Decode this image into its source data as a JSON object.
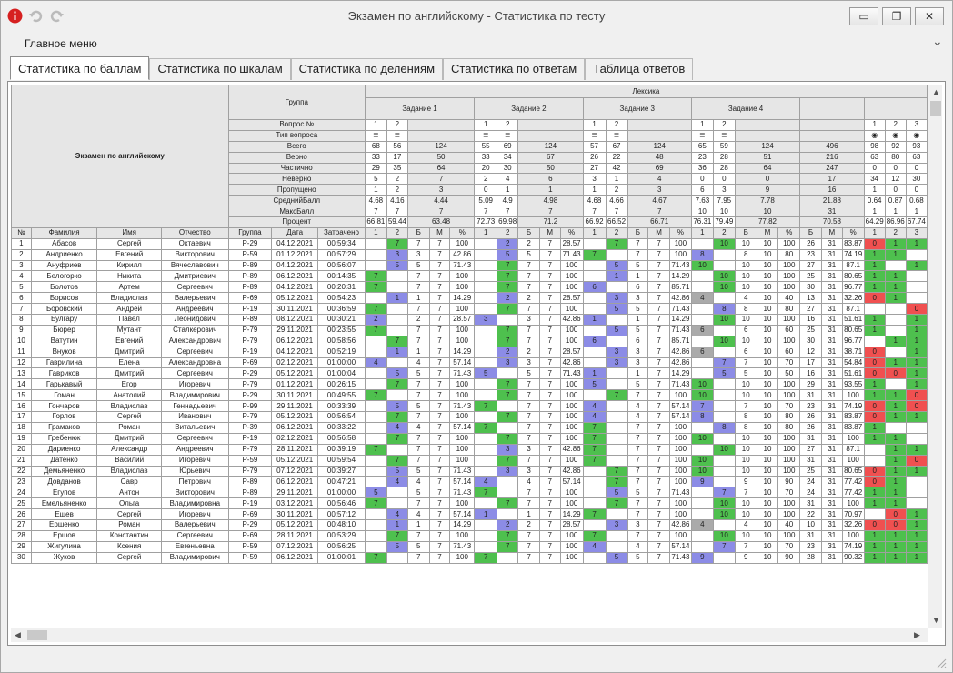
{
  "window": {
    "title": "Экзамен по английскому - Статистика по тесту",
    "min": "▭",
    "max": "❐",
    "close": "✕"
  },
  "menu": {
    "main": "Главное меню",
    "expand": "⌄"
  },
  "tabs": [
    "Статистика по баллам",
    "Статистика по шкалам",
    "Статистика по делениям",
    "Статистика по ответам",
    "Таблица ответов"
  ],
  "head": {
    "test": "Экзамен по английскому",
    "group": "Группа",
    "section": "Лексика",
    "tasks": [
      "Задание 1",
      "Задание 2",
      "Задание 3",
      "Задание 4"
    ],
    "stat_labels": [
      "Вопрос №",
      "Тип вопроса",
      "Всего",
      "Верно",
      "Частично",
      "Неверно",
      "Пропущено",
      "СреднийБалл",
      "МаксБалл",
      "Процент"
    ],
    "stats": [
      [
        "1",
        "2",
        "",
        "1",
        "2",
        "",
        "1",
        "2",
        "",
        "1",
        "2",
        "",
        "",
        "1",
        "2",
        "3"
      ],
      [
        "≣",
        "≣",
        "",
        "≣",
        "≣",
        "",
        "≣",
        "≣",
        "",
        "≣",
        "≣",
        "",
        "",
        "◉",
        "◉",
        "◉"
      ],
      [
        "68",
        "56",
        "124",
        "55",
        "69",
        "124",
        "57",
        "67",
        "124",
        "65",
        "59",
        "124",
        "496",
        "98",
        "92",
        "93"
      ],
      [
        "33",
        "17",
        "50",
        "33",
        "34",
        "67",
        "26",
        "22",
        "48",
        "23",
        "28",
        "51",
        "216",
        "63",
        "80",
        "63"
      ],
      [
        "29",
        "35",
        "64",
        "20",
        "30",
        "50",
        "27",
        "42",
        "69",
        "36",
        "28",
        "64",
        "247",
        "0",
        "0",
        "0"
      ],
      [
        "5",
        "2",
        "7",
        "2",
        "4",
        "6",
        "3",
        "1",
        "4",
        "0",
        "0",
        "0",
        "17",
        "34",
        "12",
        "30"
      ],
      [
        "1",
        "2",
        "3",
        "0",
        "1",
        "1",
        "1",
        "2",
        "3",
        "6",
        "3",
        "9",
        "16",
        "1",
        "0",
        "0"
      ],
      [
        "4.68",
        "4.16",
        "4.44",
        "5.09",
        "4.9",
        "4.98",
        "4.68",
        "4.66",
        "4.67",
        "7.63",
        "7.95",
        "7.78",
        "21.88",
        "0.64",
        "0.87",
        "0.68"
      ],
      [
        "7",
        "7",
        "7",
        "7",
        "7",
        "7",
        "7",
        "7",
        "7",
        "10",
        "10",
        "10",
        "31",
        "1",
        "1",
        "1"
      ],
      [
        "66.81",
        "59.44",
        "63.48",
        "72.73",
        "69.98",
        "71.2",
        "66.92",
        "66.52",
        "66.71",
        "76.31",
        "79.49",
        "77.82",
        "70.58",
        "64.29",
        "86.96",
        "67.74"
      ]
    ],
    "cols": [
      "№",
      "Фамилия",
      "Имя",
      "Отчество",
      "Группа",
      "Дата",
      "Затрачено",
      "1",
      "2",
      "Б",
      "М",
      "%",
      "1",
      "2",
      "Б",
      "М",
      "%",
      "1",
      "2",
      "Б",
      "М",
      "%",
      "1",
      "2",
      "Б",
      "М",
      "%",
      "Б",
      "М",
      "%",
      "1",
      "2",
      "3"
    ]
  },
  "rows": [
    [
      "1",
      "Абасов",
      "Сергей",
      "Октаевич",
      "Р-29",
      "04.12.2021",
      "00:59:34",
      "",
      "7",
      "7",
      "7",
      "100",
      "",
      "2",
      "2",
      "7",
      "28.57",
      "",
      "7",
      "7",
      "7",
      "100",
      "",
      "10",
      "10",
      "10",
      "100",
      "26",
      "31",
      "83.87",
      "0",
      "1",
      "1"
    ],
    [
      "2",
      "Андриенко",
      "Евгений",
      "Викторович",
      "Р-59",
      "01.12.2021",
      "00:57:29",
      "",
      "3",
      "3",
      "7",
      "42.86",
      "",
      "5",
      "5",
      "7",
      "71.43",
      "7",
      "",
      "7",
      "7",
      "100",
      "8",
      "",
      "8",
      "10",
      "80",
      "23",
      "31",
      "74.19",
      "1",
      "1",
      ""
    ],
    [
      "3",
      "Ануфриев",
      "Кирилл",
      "Вячеславович",
      "Р-89",
      "04.12.2021",
      "00:56:07",
      "",
      "5",
      "5",
      "7",
      "71.43",
      "",
      "7",
      "7",
      "7",
      "100",
      "",
      "5",
      "5",
      "7",
      "71.43",
      "10",
      "",
      "10",
      "10",
      "100",
      "27",
      "31",
      "87.1",
      "1",
      "",
      "1"
    ],
    [
      "4",
      "Белогорко",
      "Никита",
      "Дмитриевич",
      "Р-89",
      "06.12.2021",
      "00:14:35",
      "7",
      "",
      "7",
      "7",
      "100",
      "",
      "7",
      "7",
      "7",
      "100",
      "",
      "1",
      "1",
      "7",
      "14.29",
      "",
      "10",
      "10",
      "10",
      "100",
      "25",
      "31",
      "80.65",
      "1",
      "1",
      ""
    ],
    [
      "5",
      "Болотов",
      "Артем",
      "Сергеевич",
      "Р-89",
      "04.12.2021",
      "00:20:31",
      "7",
      "",
      "7",
      "7",
      "100",
      "",
      "7",
      "7",
      "7",
      "100",
      "6",
      "",
      "6",
      "7",
      "85.71",
      "",
      "10",
      "10",
      "10",
      "100",
      "30",
      "31",
      "96.77",
      "1",
      "1",
      ""
    ],
    [
      "6",
      "Борисов",
      "Владислав",
      "Валерьевич",
      "Р-69",
      "05.12.2021",
      "00:54:23",
      "",
      "1",
      "1",
      "7",
      "14.29",
      "",
      "2",
      "2",
      "7",
      "28.57",
      "",
      "3",
      "3",
      "7",
      "42.86",
      "4",
      "",
      "4",
      "10",
      "40",
      "13",
      "31",
      "32.26",
      "0",
      "1",
      ""
    ],
    [
      "7",
      "Боровский",
      "Андрей",
      "Андреевич",
      "Р-19",
      "30.11.2021",
      "00:36:59",
      "7",
      "",
      "7",
      "7",
      "100",
      "",
      "7",
      "7",
      "7",
      "100",
      "",
      "5",
      "5",
      "7",
      "71.43",
      "",
      "8",
      "8",
      "10",
      "80",
      "27",
      "31",
      "87.1",
      "",
      "",
      "0"
    ],
    [
      "8",
      "Булгару",
      "Павел",
      "Леонидович",
      "Р-89",
      "08.12.2021",
      "00:30:21",
      "2",
      "",
      "2",
      "7",
      "28.57",
      "3",
      "",
      "3",
      "7",
      "42.86",
      "1",
      "",
      "1",
      "7",
      "14.29",
      "",
      "10",
      "10",
      "10",
      "100",
      "16",
      "31",
      "51.61",
      "1",
      "",
      "1"
    ],
    [
      "9",
      "Бюрер",
      "Мутант",
      "Сталкерович",
      "Р-79",
      "29.11.2021",
      "00:23:55",
      "7",
      "",
      "7",
      "7",
      "100",
      "",
      "7",
      "7",
      "7",
      "100",
      "",
      "5",
      "5",
      "7",
      "71.43",
      "6",
      "",
      "6",
      "10",
      "60",
      "25",
      "31",
      "80.65",
      "1",
      "",
      "1"
    ],
    [
      "10",
      "Ватутин",
      "Евгений",
      "Александрович",
      "Р-79",
      "06.12.2021",
      "00:58:56",
      "",
      "7",
      "7",
      "7",
      "100",
      "",
      "7",
      "7",
      "7",
      "100",
      "6",
      "",
      "6",
      "7",
      "85.71",
      "",
      "10",
      "10",
      "10",
      "100",
      "30",
      "31",
      "96.77",
      "",
      "1",
      "1"
    ],
    [
      "11",
      "Внуков",
      "Дмитрий",
      "Сергеевич",
      "Р-19",
      "04.12.2021",
      "00:52:19",
      "",
      "1",
      "1",
      "7",
      "14.29",
      "",
      "2",
      "2",
      "7",
      "28.57",
      "",
      "3",
      "3",
      "7",
      "42.86",
      "6",
      "",
      "6",
      "10",
      "60",
      "12",
      "31",
      "38.71",
      "0",
      "",
      "1"
    ],
    [
      "12",
      "Гаврилина",
      "Елена",
      "Александровна",
      "Р-69",
      "02.12.2021",
      "01:00:00",
      "4",
      "",
      "4",
      "7",
      "57.14",
      "",
      "3",
      "3",
      "7",
      "42.86",
      "",
      "3",
      "3",
      "7",
      "42.86",
      "",
      "7",
      "7",
      "10",
      "70",
      "17",
      "31",
      "54.84",
      "0",
      "1",
      "1"
    ],
    [
      "13",
      "Гавриков",
      "Дмитрий",
      "Сергеевич",
      "Р-29",
      "05.12.2021",
      "01:00:04",
      "",
      "5",
      "5",
      "7",
      "71.43",
      "5",
      "",
      "5",
      "7",
      "71.43",
      "1",
      "",
      "1",
      "7",
      "14.29",
      "",
      "5",
      "5",
      "10",
      "50",
      "16",
      "31",
      "51.61",
      "0",
      "0",
      "1"
    ],
    [
      "14",
      "Гарькавый",
      "Егор",
      "Игоревич",
      "Р-79",
      "01.12.2021",
      "00:26:15",
      "",
      "7",
      "7",
      "7",
      "100",
      "",
      "7",
      "7",
      "7",
      "100",
      "5",
      "",
      "5",
      "7",
      "71.43",
      "10",
      "",
      "10",
      "10",
      "100",
      "29",
      "31",
      "93.55",
      "1",
      "",
      "1"
    ],
    [
      "15",
      "Гоман",
      "Анатолий",
      "Владимирович",
      "Р-29",
      "30.11.2021",
      "00:49:55",
      "7",
      "",
      "7",
      "7",
      "100",
      "",
      "7",
      "7",
      "7",
      "100",
      "",
      "7",
      "7",
      "7",
      "100",
      "10",
      "",
      "10",
      "10",
      "100",
      "31",
      "31",
      "100",
      "1",
      "1",
      "0"
    ],
    [
      "16",
      "Гончаров",
      "Владислав",
      "Геннадьевич",
      "Р-99",
      "29.11.2021",
      "00:33:39",
      "",
      "5",
      "5",
      "7",
      "71.43",
      "7",
      "",
      "7",
      "7",
      "100",
      "4",
      "",
      "4",
      "7",
      "57.14",
      "7",
      "",
      "7",
      "10",
      "70",
      "23",
      "31",
      "74.19",
      "0",
      "1",
      "0"
    ],
    [
      "17",
      "Горлов",
      "Сергей",
      "Иванович",
      "Р-79",
      "05.12.2021",
      "00:56:54",
      "",
      "7",
      "7",
      "7",
      "100",
      "",
      "7",
      "7",
      "7",
      "100",
      "4",
      "",
      "4",
      "7",
      "57.14",
      "8",
      "",
      "8",
      "10",
      "80",
      "26",
      "31",
      "83.87",
      "0",
      "1",
      "1"
    ],
    [
      "18",
      "Грамаков",
      "Роман",
      "Витальевич",
      "Р-39",
      "06.12.2021",
      "00:33:22",
      "",
      "4",
      "4",
      "7",
      "57.14",
      "7",
      "",
      "7",
      "7",
      "100",
      "7",
      "",
      "7",
      "7",
      "100",
      "",
      "8",
      "8",
      "10",
      "80",
      "26",
      "31",
      "83.87",
      "1",
      "",
      ""
    ],
    [
      "19",
      "Гребенюк",
      "Дмитрий",
      "Сергеевич",
      "Р-19",
      "02.12.2021",
      "00:56:58",
      "",
      "7",
      "7",
      "7",
      "100",
      "",
      "7",
      "7",
      "7",
      "100",
      "7",
      "",
      "7",
      "7",
      "100",
      "10",
      "",
      "10",
      "10",
      "100",
      "31",
      "31",
      "100",
      "1",
      "1",
      ""
    ],
    [
      "20",
      "Дариенко",
      "Александр",
      "Андреевич",
      "Р-79",
      "28.11.2021",
      "00:39:19",
      "7",
      "",
      "7",
      "7",
      "100",
      "",
      "3",
      "3",
      "7",
      "42.86",
      "7",
      "",
      "7",
      "7",
      "100",
      "",
      "10",
      "10",
      "10",
      "100",
      "27",
      "31",
      "87.1",
      "",
      "1",
      "1"
    ],
    [
      "21",
      "Датенко",
      "Василий",
      "Игоревич",
      "Р-59",
      "05.12.2021",
      "00:59:54",
      "",
      "7",
      "7",
      "7",
      "100",
      "",
      "7",
      "7",
      "7",
      "100",
      "7",
      "",
      "7",
      "7",
      "100",
      "10",
      "",
      "10",
      "10",
      "100",
      "31",
      "31",
      "100",
      "",
      "1",
      "0"
    ],
    [
      "22",
      "Демьяненко",
      "Владислав",
      "Юрьевич",
      "Р-79",
      "07.12.2021",
      "00:39:27",
      "",
      "5",
      "5",
      "7",
      "71.43",
      "",
      "3",
      "3",
      "7",
      "42.86",
      "",
      "7",
      "7",
      "7",
      "100",
      "10",
      "",
      "10",
      "10",
      "100",
      "25",
      "31",
      "80.65",
      "0",
      "1",
      "1"
    ],
    [
      "23",
      "Довданов",
      "Савр",
      "Петрович",
      "Р-89",
      "06.12.2021",
      "00:47:21",
      "",
      "4",
      "4",
      "7",
      "57.14",
      "4",
      "",
      "4",
      "7",
      "57.14",
      "",
      "7",
      "7",
      "7",
      "100",
      "9",
      "",
      "9",
      "10",
      "90",
      "24",
      "31",
      "77.42",
      "0",
      "1",
      ""
    ],
    [
      "24",
      "Егупов",
      "Антон",
      "Викторович",
      "Р-89",
      "29.11.2021",
      "01:00:00",
      "5",
      "",
      "5",
      "7",
      "71.43",
      "7",
      "",
      "7",
      "7",
      "100",
      "",
      "5",
      "5",
      "7",
      "71.43",
      "",
      "7",
      "7",
      "10",
      "70",
      "24",
      "31",
      "77.42",
      "1",
      "1",
      ""
    ],
    [
      "25",
      "Емельяненко",
      "Ольга",
      "Владимировна",
      "Р-19",
      "03.12.2021",
      "00:56:46",
      "7",
      "",
      "7",
      "7",
      "100",
      "",
      "7",
      "7",
      "7",
      "100",
      "",
      "7",
      "7",
      "7",
      "100",
      "",
      "10",
      "10",
      "10",
      "100",
      "31",
      "31",
      "100",
      "1",
      "1",
      ""
    ],
    [
      "26",
      "Ещев",
      "Сергей",
      "Игоревич",
      "Р-69",
      "30.11.2021",
      "00:57:12",
      "",
      "4",
      "4",
      "7",
      "57.14",
      "1",
      "",
      "1",
      "7",
      "14.29",
      "7",
      "",
      "7",
      "7",
      "100",
      "",
      "10",
      "10",
      "10",
      "100",
      "22",
      "31",
      "70.97",
      "",
      "0",
      "1"
    ],
    [
      "27",
      "Ершенко",
      "Роман",
      "Валерьевич",
      "Р-29",
      "05.12.2021",
      "00:48:10",
      "",
      "1",
      "1",
      "7",
      "14.29",
      "",
      "2",
      "2",
      "7",
      "28.57",
      "",
      "3",
      "3",
      "7",
      "42.86",
      "4",
      "",
      "4",
      "10",
      "40",
      "10",
      "31",
      "32.26",
      "0",
      "0",
      "1"
    ],
    [
      "28",
      "Ершов",
      "Константин",
      "Сергеевич",
      "Р-69",
      "28.11.2021",
      "00:53:29",
      "",
      "7",
      "7",
      "7",
      "100",
      "",
      "7",
      "7",
      "7",
      "100",
      "7",
      "",
      "7",
      "7",
      "100",
      "",
      "10",
      "10",
      "10",
      "100",
      "31",
      "31",
      "100",
      "1",
      "1",
      "1"
    ],
    [
      "29",
      "Жигулина",
      "Ксения",
      "Евгеньевна",
      "Р-59",
      "07.12.2021",
      "00:56:25",
      "",
      "5",
      "5",
      "7",
      "71.43",
      "",
      "7",
      "7",
      "7",
      "100",
      "4",
      "",
      "4",
      "7",
      "57.14",
      "",
      "7",
      "7",
      "10",
      "70",
      "23",
      "31",
      "74.19",
      "1",
      "1",
      "1"
    ],
    [
      "30",
      "Жуков",
      "Сергей",
      "Владимирович",
      "Р-59",
      "06.12.2021",
      "01:00:01",
      "7",
      "",
      "7",
      "7",
      "100",
      "7",
      "",
      "7",
      "7",
      "100",
      "",
      "5",
      "5",
      "7",
      "71.43",
      "9",
      "",
      "9",
      "10",
      "90",
      "28",
      "31",
      "90.32",
      "1",
      "1",
      "1"
    ]
  ]
}
